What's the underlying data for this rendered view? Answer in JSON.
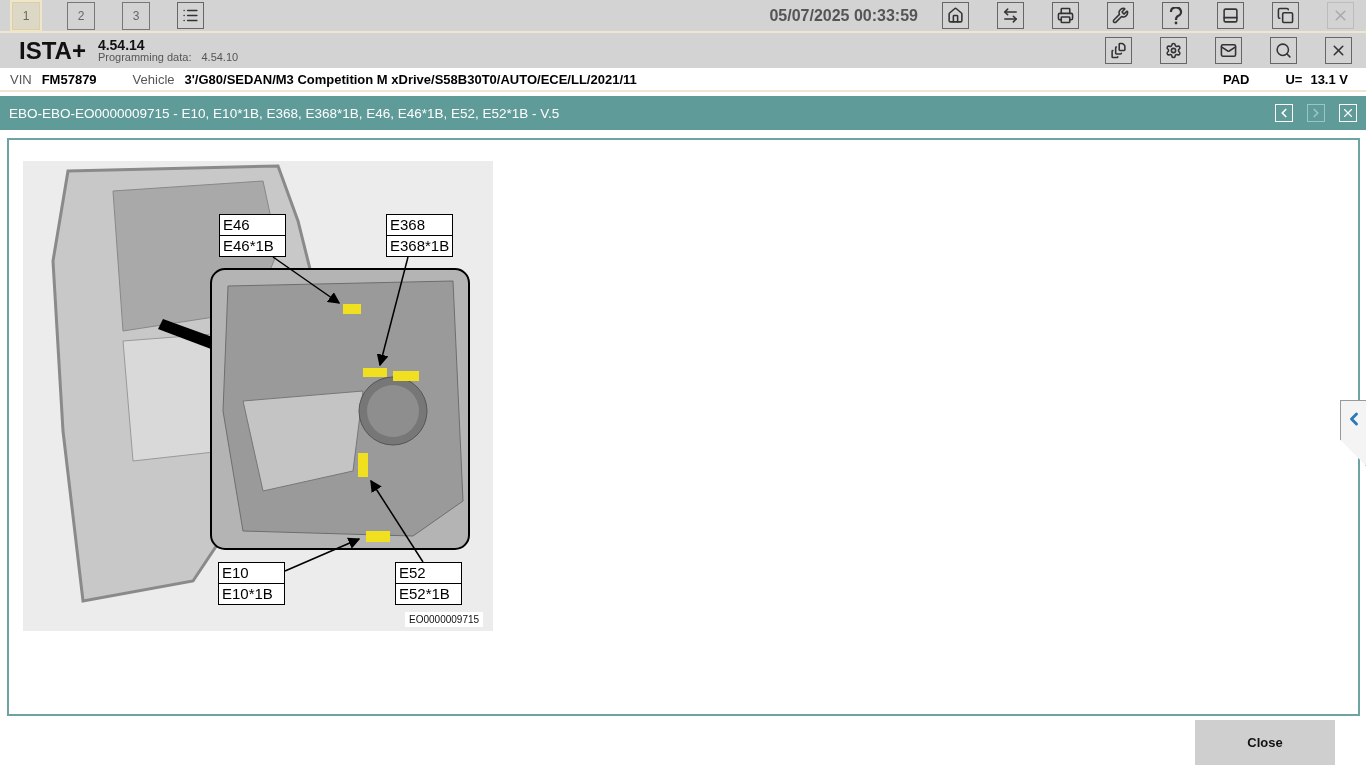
{
  "top_bar": {
    "tabs": [
      {
        "label": "1",
        "selected": true
      },
      {
        "label": "2",
        "selected": false
      },
      {
        "label": "3",
        "selected": false
      }
    ],
    "datetime": "05/07/2025 00:33:59"
  },
  "header": {
    "app_name": "ISTA+",
    "version": "4.54.14",
    "programming_label": "Programming data:",
    "programming_version": "4.54.10"
  },
  "vehicle_bar": {
    "vin_label": "VIN",
    "vin": "FM57879",
    "vehicle_label": "Vehicle",
    "vehicle": "3'/G80/SEDAN/M3 Competition M xDrive/S58B30T0/AUTO/ECE/LL/2021/11",
    "pad": "PAD",
    "voltage_label": "U=",
    "voltage": "13.1 V"
  },
  "document": {
    "title": "EBO-EBO-EO0000009715 - E10, E10*1B, E368, E368*1B, E46, E46*1B, E52, E52*1B - V.5",
    "next_disabled": true,
    "diagram": {
      "caption": "EO0000009715",
      "callouts": [
        {
          "lines": [
            "E46",
            "E46*1B"
          ]
        },
        {
          "lines": [
            "E368",
            "E368*1B"
          ]
        },
        {
          "lines": [
            "E10",
            "E10*1B"
          ]
        },
        {
          "lines": [
            "E52",
            "E52*1B"
          ]
        }
      ]
    }
  },
  "footer": {
    "close_label": "Close"
  }
}
